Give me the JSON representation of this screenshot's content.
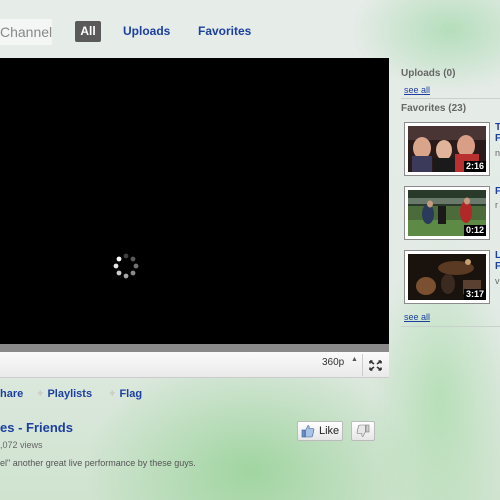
{
  "nav": {
    "channel_label": "Channel",
    "all_label": "All",
    "uploads_label": "Uploads",
    "favorites_label": "Favorites"
  },
  "player": {
    "quality": "360p",
    "quality_arrow": "▲"
  },
  "actions": {
    "share": "hare",
    "playlists": "Playlists",
    "flag": "Flag"
  },
  "video": {
    "title": "es - Friends",
    "views": ",072 views",
    "description": "el\" another great live performance by these guys.",
    "like_label": "Like"
  },
  "sidebar": {
    "uploads_header": "Uploads (0)",
    "uploads_see_all": "see all",
    "favorites_header": "Favorites (23)",
    "favorites_see_all": "see all",
    "favorites": [
      {
        "duration": "2:16",
        "title_fragment": "T\nF",
        "sub_fragment": "n"
      },
      {
        "duration": "0:12",
        "title_fragment": "F",
        "sub_fragment": "r"
      },
      {
        "duration": "3:17",
        "title_fragment": "L\nF",
        "sub_fragment": "v"
      }
    ]
  },
  "colors": {
    "link": "#1c3fa0",
    "all_tab_bg": "#5a5a5a",
    "video_bg": "#000000"
  }
}
